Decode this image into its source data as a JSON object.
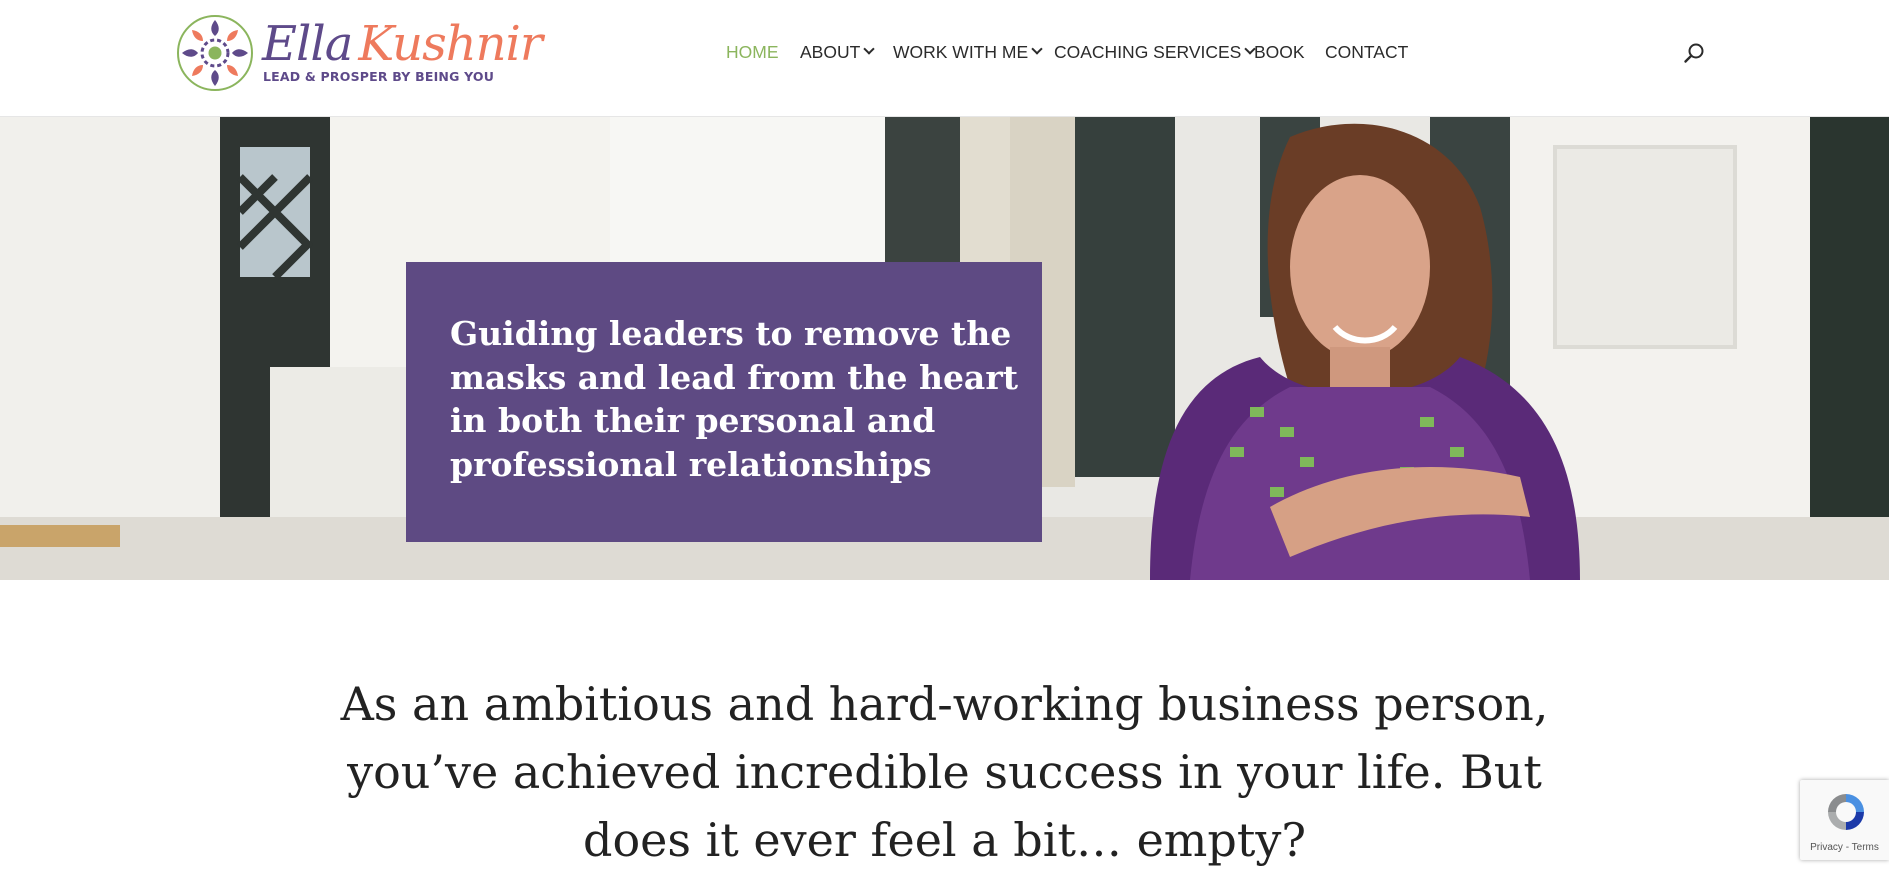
{
  "header": {
    "logo": {
      "first_name": "Ella",
      "last_name": "Kushnir",
      "tagline": "LEAD & PROSPER BY BEING YOU"
    },
    "nav": [
      {
        "label": "HOME",
        "active": true,
        "has_dropdown": false
      },
      {
        "label": "ABOUT",
        "active": false,
        "has_dropdown": true
      },
      {
        "label": "WORK WITH ME",
        "active": false,
        "has_dropdown": true
      },
      {
        "label": "COACHING SERVICES",
        "active": false,
        "has_dropdown": true
      },
      {
        "label": "BOOK",
        "active": false,
        "has_dropdown": false
      },
      {
        "label": "CONTACT",
        "active": false,
        "has_dropdown": false
      }
    ],
    "search_icon": "search-icon"
  },
  "hero": {
    "headline": "Guiding leaders to remove the masks and lead from the heart in both their personal and professional relationships"
  },
  "intro": {
    "text": "As an ambitious and hard-working business person, you’ve achieved incredible success in your life. But does it ever feel a bit… empty?"
  },
  "recaptcha": {
    "privacy": "Privacy",
    "separator": " - ",
    "terms": "Terms"
  },
  "colors": {
    "accent_purple": "#5e4a83",
    "accent_green": "#8bb55d",
    "accent_coral": "#ee7a5d"
  }
}
